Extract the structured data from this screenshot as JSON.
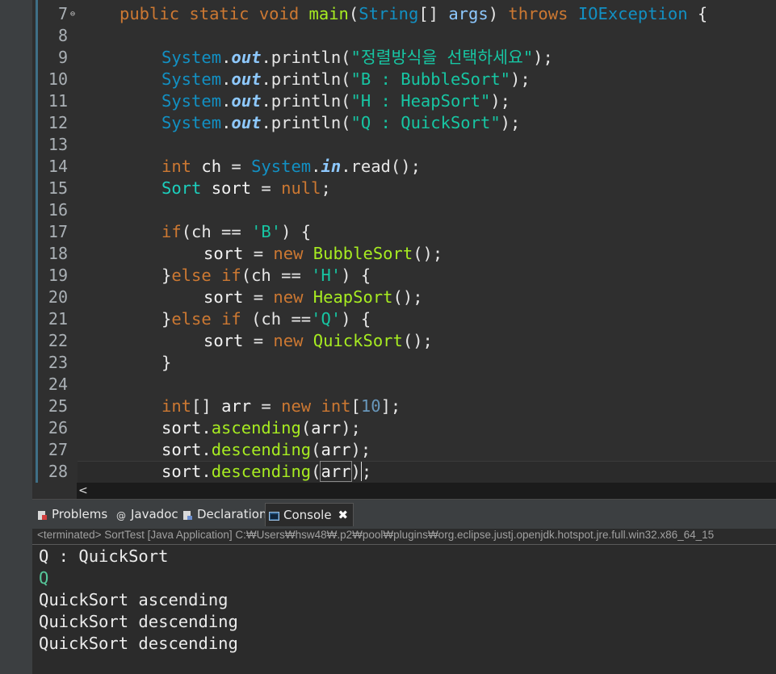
{
  "editor": {
    "lines": [
      {
        "n": "7",
        "fold": "⊖"
      },
      {
        "n": "8"
      },
      {
        "n": "9"
      },
      {
        "n": "10"
      },
      {
        "n": "11"
      },
      {
        "n": "12"
      },
      {
        "n": "13"
      },
      {
        "n": "14"
      },
      {
        "n": "15"
      },
      {
        "n": "16"
      },
      {
        "n": "17"
      },
      {
        "n": "18"
      },
      {
        "n": "19"
      },
      {
        "n": "20"
      },
      {
        "n": "21"
      },
      {
        "n": "22"
      },
      {
        "n": "23"
      },
      {
        "n": "24"
      },
      {
        "n": "25"
      },
      {
        "n": "26"
      },
      {
        "n": "27"
      },
      {
        "n": "28"
      }
    ],
    "code": {
      "l7": [
        "public",
        " ",
        "static",
        " ",
        "void",
        " ",
        "main",
        "(",
        "String",
        "[] ",
        "args",
        ") ",
        "throws",
        " ",
        "IOException",
        " {"
      ],
      "l9": [
        "System",
        ".",
        "out",
        ".println(",
        "\"정렬방식을 선택하세요\"",
        ");"
      ],
      "l10": [
        "System",
        ".",
        "out",
        ".println(",
        "\"B : BubbleSort\"",
        ");"
      ],
      "l11": [
        "System",
        ".",
        "out",
        ".println(",
        "\"H : HeapSort\"",
        ");"
      ],
      "l12": [
        "System",
        ".",
        "out",
        ".println(",
        "\"Q : QuickSort\"",
        ");"
      ],
      "l14": [
        "int",
        " ",
        "ch",
        " = ",
        "System",
        ".",
        "in",
        ".read();"
      ],
      "l15": [
        "Sort",
        " ",
        "sort",
        " = ",
        "null",
        ";"
      ],
      "l17": [
        "if",
        "(ch == ",
        "'B'",
        ") {"
      ],
      "l18": [
        "sort",
        " = ",
        "new",
        " ",
        "BubbleSort",
        "();"
      ],
      "l19": [
        "}",
        "else",
        " ",
        "if",
        "(ch == ",
        "'H'",
        ") {"
      ],
      "l20": [
        "sort",
        " = ",
        "new",
        " ",
        "HeapSort",
        "();"
      ],
      "l21": [
        "}",
        "else",
        " ",
        "if",
        " (ch ==",
        "'Q'",
        ") {"
      ],
      "l22": [
        "sort",
        " = ",
        "new",
        " ",
        "QuickSort",
        "();"
      ],
      "l23": [
        "}"
      ],
      "l25": [
        "int",
        "[] ",
        "arr",
        " = ",
        "new",
        " ",
        "int",
        "[",
        "10",
        "];"
      ],
      "l26": [
        "sort",
        ".",
        "ascending",
        "(",
        "arr",
        ");"
      ],
      "l27": [
        "sort",
        ".",
        "descending",
        "(",
        "arr",
        ");"
      ],
      "l28": [
        "sort",
        ".",
        "descending",
        "(",
        "arr",
        ")",
        ";"
      ]
    }
  },
  "scroll": {
    "left_arrow": "<"
  },
  "tabs": [
    {
      "label": "Problems"
    },
    {
      "label": "Javadoc"
    },
    {
      "label": "Declaration"
    },
    {
      "label": "Console",
      "close": "✖"
    }
  ],
  "console": {
    "status": "<terminated> SortTest [Java Application] C:₩Users₩hsw48₩.p2₩pool₩plugins₩org.eclipse.justj.openjdk.hotspot.jre.full.win32.x86_64_15",
    "output": [
      "Q : QuickSort",
      "Q",
      "QuickSort ascending",
      "QuickSort descending",
      "QuickSort descending"
    ]
  },
  "colors": {
    "keyword": "#cc7832",
    "type": "#1290c3",
    "method": "#a7ec21",
    "string": "#17c6a3",
    "field": "#8ec9ff",
    "input": "#57c89b"
  }
}
